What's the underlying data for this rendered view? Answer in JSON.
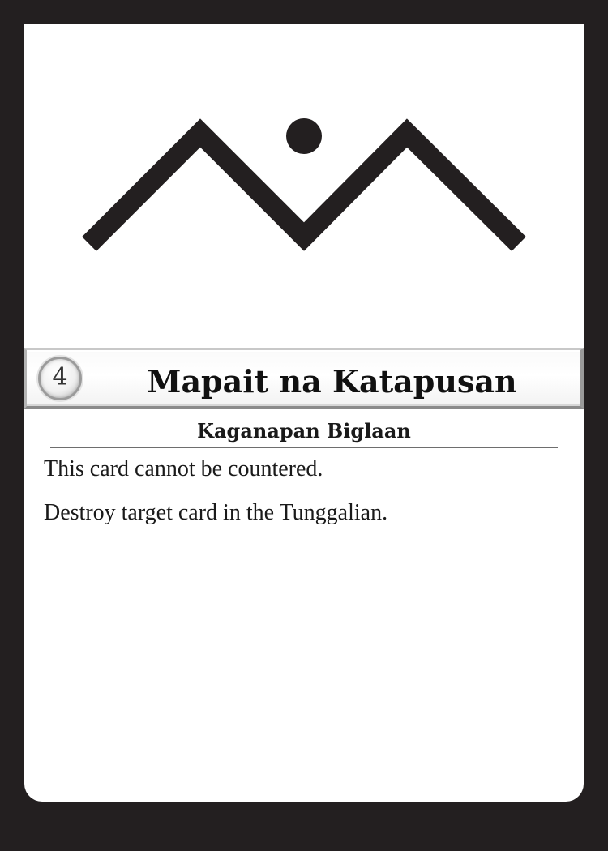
{
  "card": {
    "cost": "4",
    "name": "Mapait na Katapusan",
    "type_line": "Kaganapan Biglaan",
    "rules_text": [
      "This card cannot be countered.",
      "Destroy target card in the Tunggalian."
    ],
    "art_icon": "mountain-sun-glyph"
  },
  "colors": {
    "border": "#231f20",
    "face": "#ffffff",
    "ink": "#231f20",
    "frame_silver": "#9b9b9b"
  }
}
